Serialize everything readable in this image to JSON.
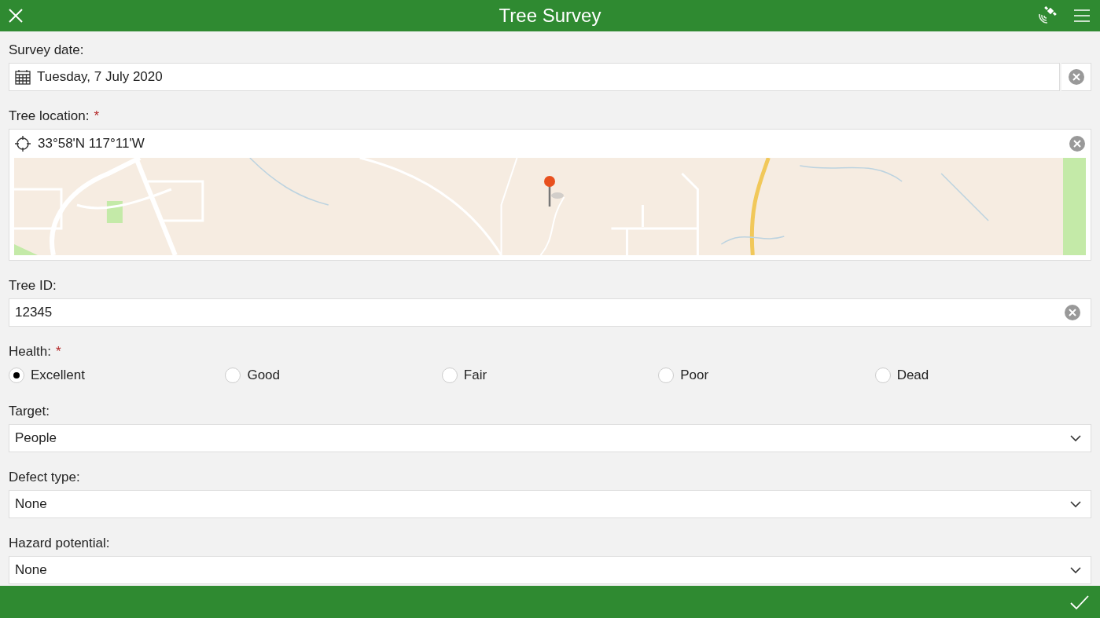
{
  "header": {
    "title": "Tree Survey"
  },
  "fields": [
    {
      "kind": "date",
      "label": "Survey date:",
      "value": "Tuesday, 7 July 2020"
    },
    {
      "kind": "location",
      "label": "Tree location:",
      "required_mark": "*",
      "value": "33°58'N 117°11'W"
    },
    {
      "kind": "text",
      "label": "Tree ID:",
      "value": "12345"
    },
    {
      "kind": "radio",
      "label": "Health:",
      "required_mark": "*",
      "options": [
        {
          "label": "Excellent",
          "selected": true
        },
        {
          "label": "Good",
          "selected": false
        },
        {
          "label": "Fair",
          "selected": false
        },
        {
          "label": "Poor",
          "selected": false
        },
        {
          "label": "Dead",
          "selected": false
        }
      ]
    },
    {
      "kind": "select",
      "label": "Target:",
      "value": "People"
    },
    {
      "kind": "select",
      "label": "Defect type:",
      "value": "None"
    },
    {
      "kind": "select",
      "label": "Hazard potential:",
      "value": "None"
    }
  ]
}
